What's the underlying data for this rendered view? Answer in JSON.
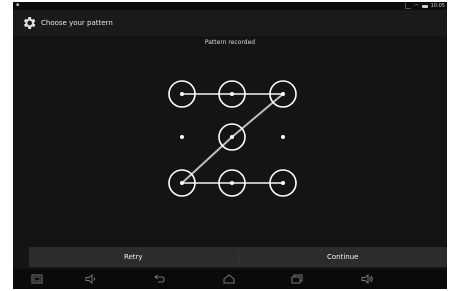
{
  "status_bar": {
    "time": "10:05",
    "icons": [
      "notification-icon",
      "signal-icon",
      "wifi-icon",
      "battery-icon"
    ]
  },
  "action_bar": {
    "icon": "gear-icon",
    "title": "Choose your pattern"
  },
  "pattern": {
    "message": "Pattern recorded",
    "grid_size": 3,
    "selected_sequence": [
      1,
      2,
      3,
      5,
      7,
      8,
      9
    ],
    "unselected": [
      4,
      6
    ],
    "line_color": "#bdbdbd",
    "dot_color": "#ffffff"
  },
  "buttons": {
    "retry_label": "Retry",
    "continue_label": "Continue"
  },
  "nav_bar": {
    "icons": [
      "screenshot-icon",
      "volume-down-icon",
      "back-icon",
      "home-icon",
      "recent-apps-icon",
      "volume-up-icon"
    ]
  },
  "colors": {
    "background": "#141414",
    "action_bar": "#1a1a1a",
    "button_bar": "#2c2c2c",
    "nav_bar": "#0a0a0a",
    "text": "#e8e8e8"
  }
}
